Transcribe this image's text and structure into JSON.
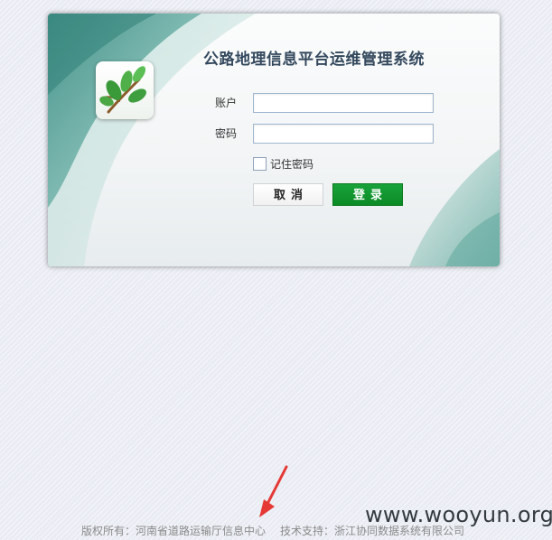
{
  "app": {
    "title": "公路地理信息平台运维管理系统"
  },
  "login_form": {
    "account_label": "账户",
    "account_value": "",
    "password_label": "密码",
    "password_value": "",
    "remember_label": "记住密码",
    "remember_checked": false,
    "cancel_label": "取消",
    "login_label": "登录"
  },
  "footer": {
    "copyright": "版权所有：河南省道路运输厅信息中心",
    "support": "技术支持：浙江协同数据系统有限公司"
  },
  "watermark": {
    "text": "www.wooyun.org"
  },
  "icons": {
    "logo": "leaf-branch-icon",
    "annotation": "red-arrow-icon"
  },
  "colors": {
    "card_accent": "#5aa39a",
    "login_button": "#0f9a2f",
    "title_text": "#34495e",
    "arrow": "#e53935"
  }
}
